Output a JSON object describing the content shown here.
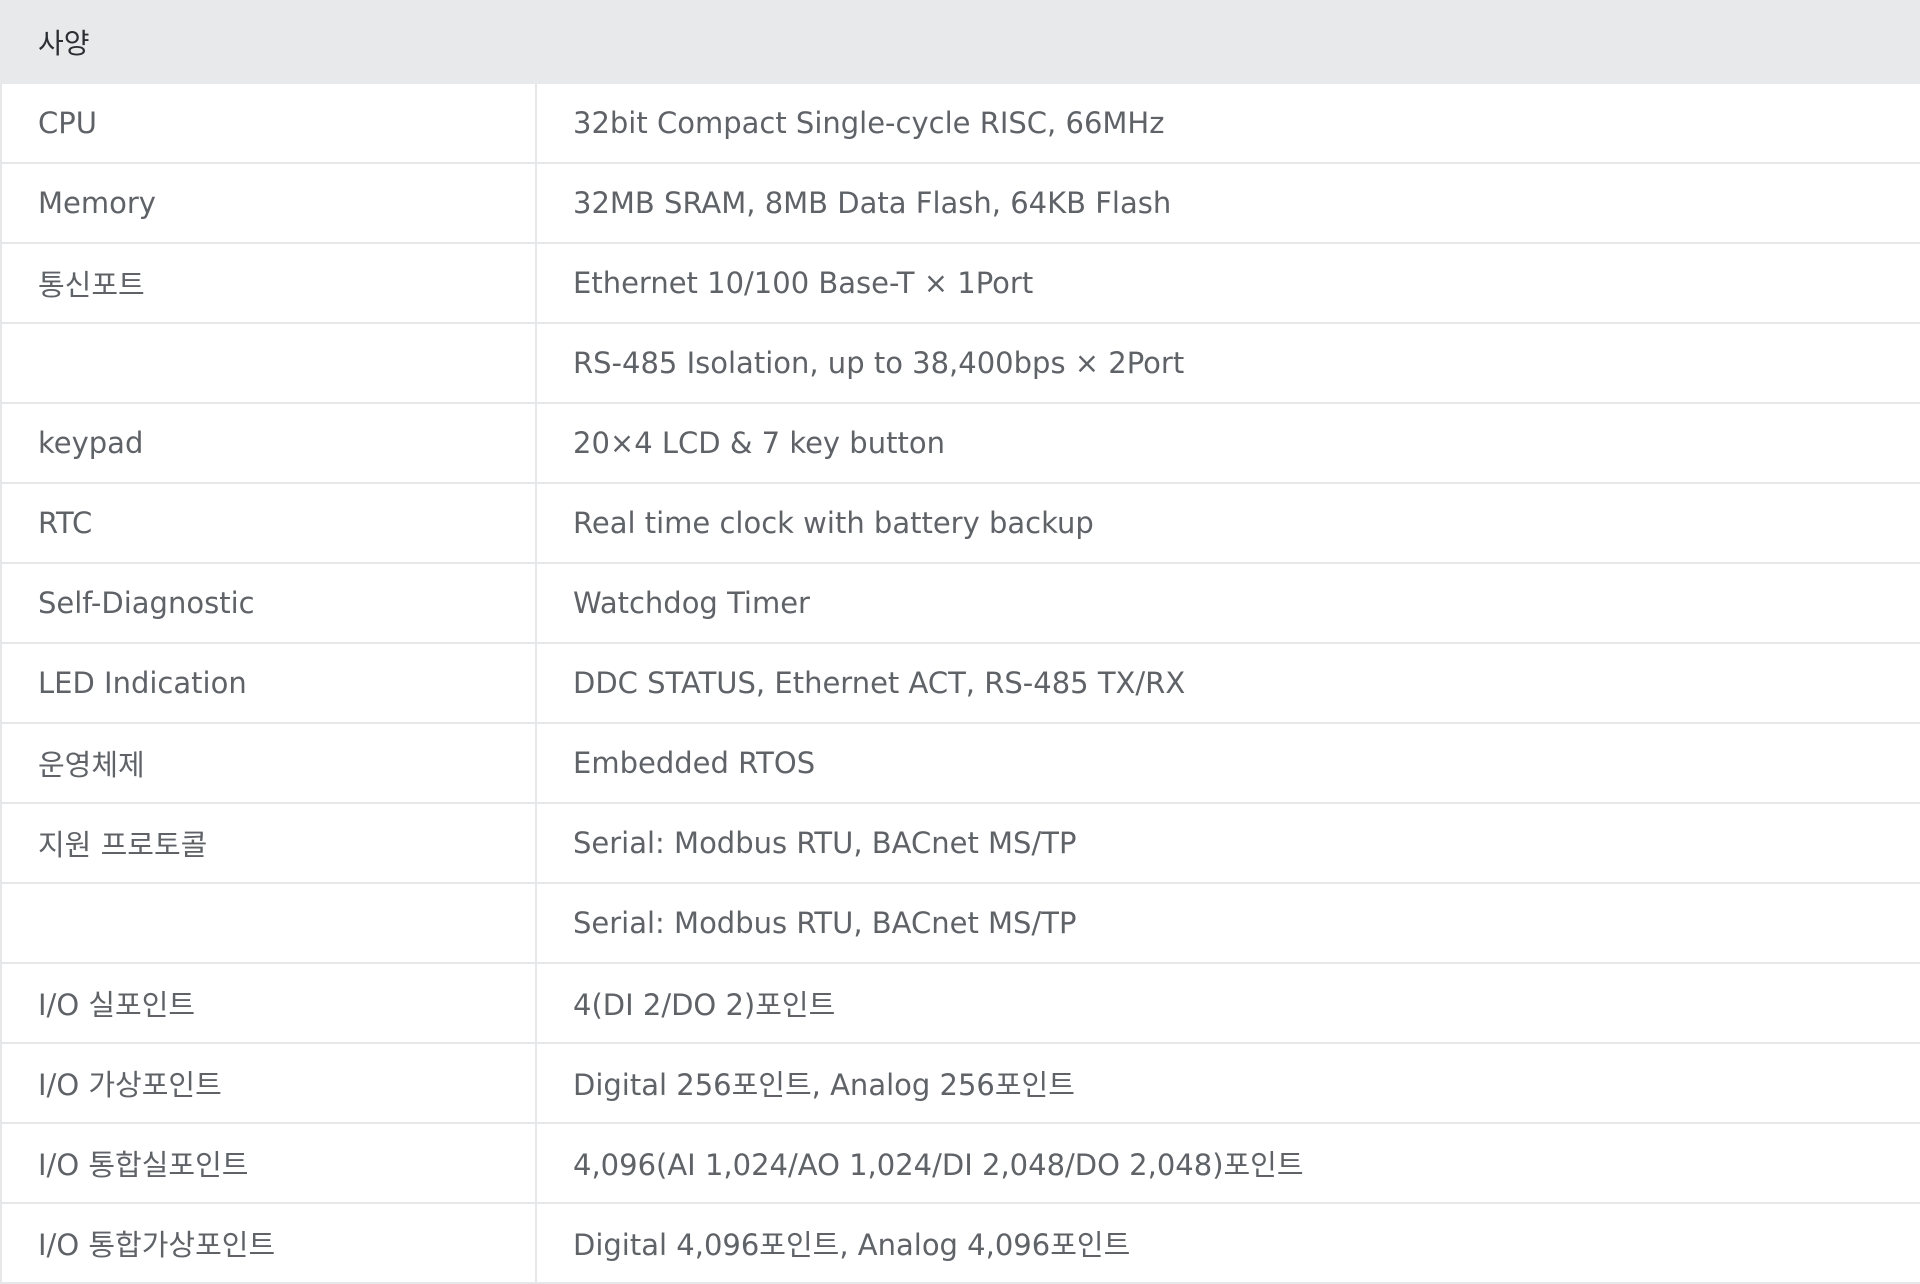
{
  "table": {
    "header": "사양",
    "rows": [
      {
        "label": "CPU",
        "value": "32bit Compact Single-cycle RISC, 66MHz"
      },
      {
        "label": "Memory",
        "value": "32MB SRAM, 8MB Data Flash, 64KB Flash"
      },
      {
        "label": "통신포트",
        "value": "Ethernet 10/100 Base-T × 1Port"
      },
      {
        "label": "",
        "value": "RS-485 Isolation, up to 38,400bps × 2Port"
      },
      {
        "label": "keypad",
        "value": "20×4 LCD & 7 key button"
      },
      {
        "label": "RTC",
        "value": "Real time clock with battery backup"
      },
      {
        "label": "Self-Diagnostic",
        "value": "Watchdog Timer"
      },
      {
        "label": "LED Indication",
        "value": "DDC STATUS, Ethernet ACT, RS-485 TX/RX"
      },
      {
        "label": "운영체제",
        "value": "Embedded RTOS"
      },
      {
        "label": "지원 프로토콜",
        "value": "Serial: Modbus RTU, BACnet MS/TP"
      },
      {
        "label": "",
        "value": "Serial: Modbus RTU, BACnet MS/TP"
      },
      {
        "label": "I/O 실포인트",
        "value": "4(DI 2/DO 2)포인트"
      },
      {
        "label": "I/O 가상포인트",
        "value": "Digital 256포인트, Analog 256포인트"
      },
      {
        "label": "I/O 통합실포인트",
        "value": "4,096(AI 1,024/AO 1,024/DI 2,048/DO 2,048)포인트"
      },
      {
        "label": "I/O 통합가상포인트",
        "value": "Digital 4,096포인트, Analog 4,096포인트"
      }
    ]
  }
}
